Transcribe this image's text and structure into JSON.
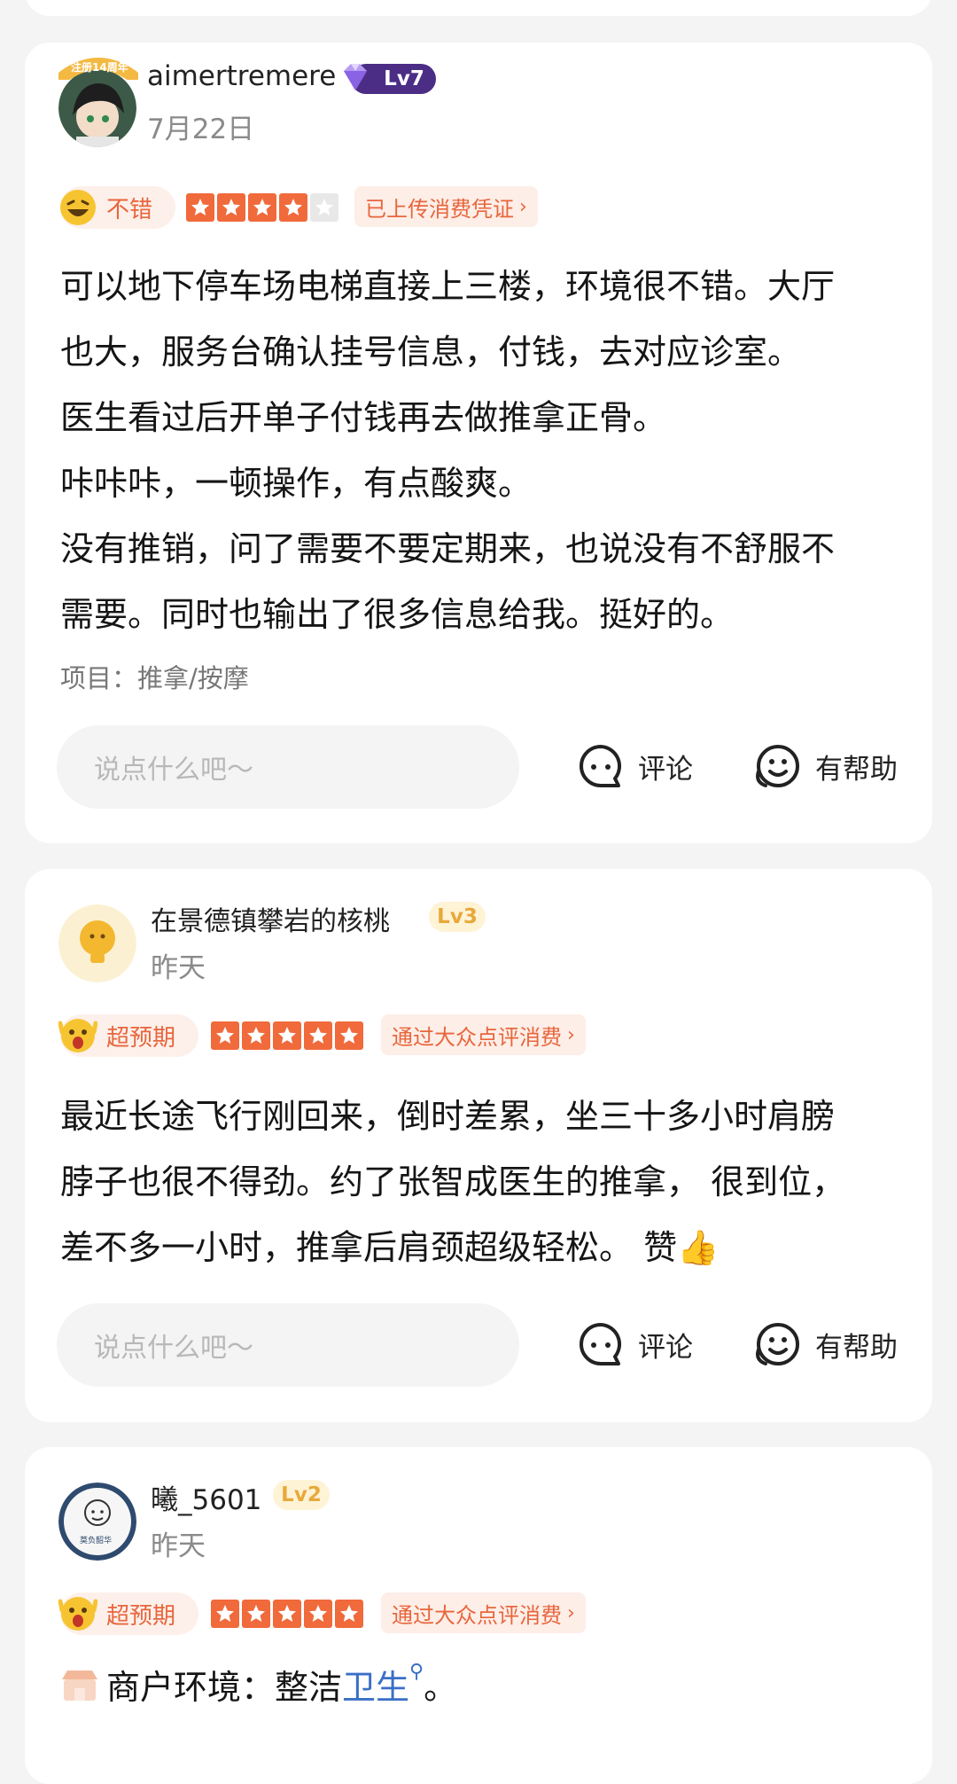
{
  "reviews": [
    {
      "username": "aimertremere",
      "level": "Lv7",
      "date": "7月22日",
      "avatar_badge": "注册14周年",
      "rating_label": "不错",
      "stars": 4,
      "tag": "已上传消费凭证",
      "lines": [
        "可以地下停车场电梯直接上三楼，环境很不错。大厅",
        "也大，服务台确认挂号信息，付钱，去对应诊室。",
        "医生看过后开单子付钱再去做推拿正骨。",
        "咔咔咔，一顿操作，有点酸爽。",
        "没有推销，问了需要不要定期来，也说没有不舒服不",
        "需要。同时也输出了很多信息给我。挺好的。"
      ],
      "project": "项目：推拿/按摩",
      "comment_placeholder": "说点什么吧～",
      "comment_label": "评论",
      "helpful_label": "有帮助"
    },
    {
      "username": "在景德镇攀岩的核桃",
      "level": "Lv3",
      "date": "昨天",
      "rating_label": "超预期",
      "stars": 5,
      "tag": "通过大众点评消费",
      "lines": [
        "最近长途飞行刚回来，倒时差累，坐三十多小时肩膀",
        "脖子也很不得劲。约了张智成医生的推拿， 很到位，",
        "差不多一小时，推拿后肩颈超级轻松。 赞👍"
      ],
      "comment_placeholder": "说点什么吧～",
      "comment_label": "评论",
      "helpful_label": "有帮助"
    },
    {
      "username": "曦_5601",
      "level": "Lv2",
      "date": "昨天",
      "avatar_text": "莫负韶华",
      "rating_label": "超预期",
      "stars": 5,
      "tag": "通过大众点评消费",
      "env_prefix": "商户环境：整洁",
      "env_link": "卫生",
      "env_suffix": "。"
    }
  ],
  "colors": {
    "accent": "#f06a3b",
    "tag_bg": "#fdeee7",
    "lv7_bg": "#4b2d86",
    "lv_light_bg": "#fff3d6",
    "lv_light_text": "#e8a93b",
    "link": "#3a6fc7"
  },
  "icons": {
    "comment": "comment-bubble-icon",
    "helpful": "helpful-face-icon",
    "star": "star-icon",
    "gem": "gem-icon"
  }
}
